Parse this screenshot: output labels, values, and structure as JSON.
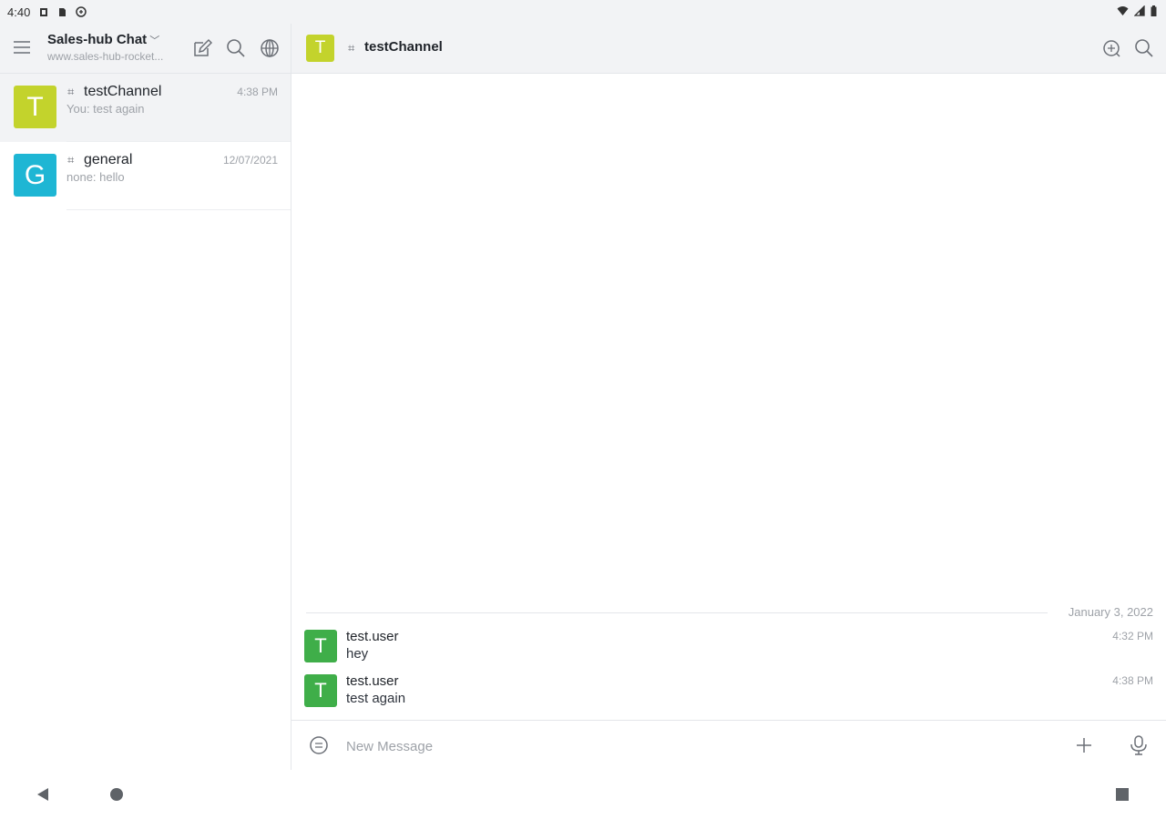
{
  "status_bar": {
    "time": "4:40"
  },
  "sidebar": {
    "server_name": "Sales-hub Chat",
    "server_url": "www.sales-hub-rocket...",
    "rooms": [
      {
        "initial": "T",
        "name": "testChannel",
        "time": "4:38 PM",
        "last_message": "You: test again",
        "color": "#c3d32c",
        "active": true
      },
      {
        "initial": "G",
        "name": "general",
        "time": "12/07/2021",
        "last_message": "none: hello",
        "color": "#1eb6d4",
        "active": false
      }
    ]
  },
  "channel": {
    "initial": "T",
    "name": "testChannel",
    "avatar_color": "#c3d32c"
  },
  "messages": {
    "date_separator": "January 3, 2022",
    "items": [
      {
        "initial": "T",
        "user": "test.user",
        "text": "hey",
        "time": "4:32 PM",
        "avatar_color": "#3fae49"
      },
      {
        "initial": "T",
        "user": "test.user",
        "text": "test again",
        "time": "4:38 PM",
        "avatar_color": "#3fae49"
      }
    ]
  },
  "composer": {
    "placeholder": "New Message"
  },
  "icons": {
    "hamburger": "menu-icon",
    "create": "edit-icon",
    "search": "search-icon",
    "directory": "globe-icon",
    "threads": "threads-icon",
    "emoji": "emoji-icon",
    "attach": "plus-icon",
    "mic": "mic-icon"
  }
}
